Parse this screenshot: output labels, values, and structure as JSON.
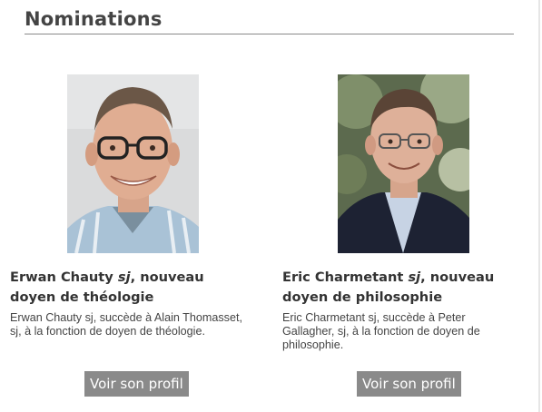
{
  "section": {
    "title": "Nominations"
  },
  "nominations": [
    {
      "name": "Erwan Chauty",
      "sj": "sj",
      "title_rest": ", nouveau doyen de théologie",
      "description": "Erwan Chauty sj, succède à Alain Thomasset, sj, à la fonction de doyen de théologie.",
      "button_label": "Voir son profil",
      "photo_alt": "Erwan Chauty"
    },
    {
      "name": "Eric Charmetant",
      "sj": "sj",
      "title_rest": ", nouveau doyen de philosophie",
      "description": "Eric Charmetant sj, succède à Peter Gallagher, sj, à la fonction de doyen de philosophie.",
      "button_label": "Voir son profil",
      "photo_alt": "Eric Charmetant"
    }
  ],
  "colors": {
    "button_bg": "#8a8a8a",
    "title_text": "#444444",
    "rule": "#888888"
  }
}
